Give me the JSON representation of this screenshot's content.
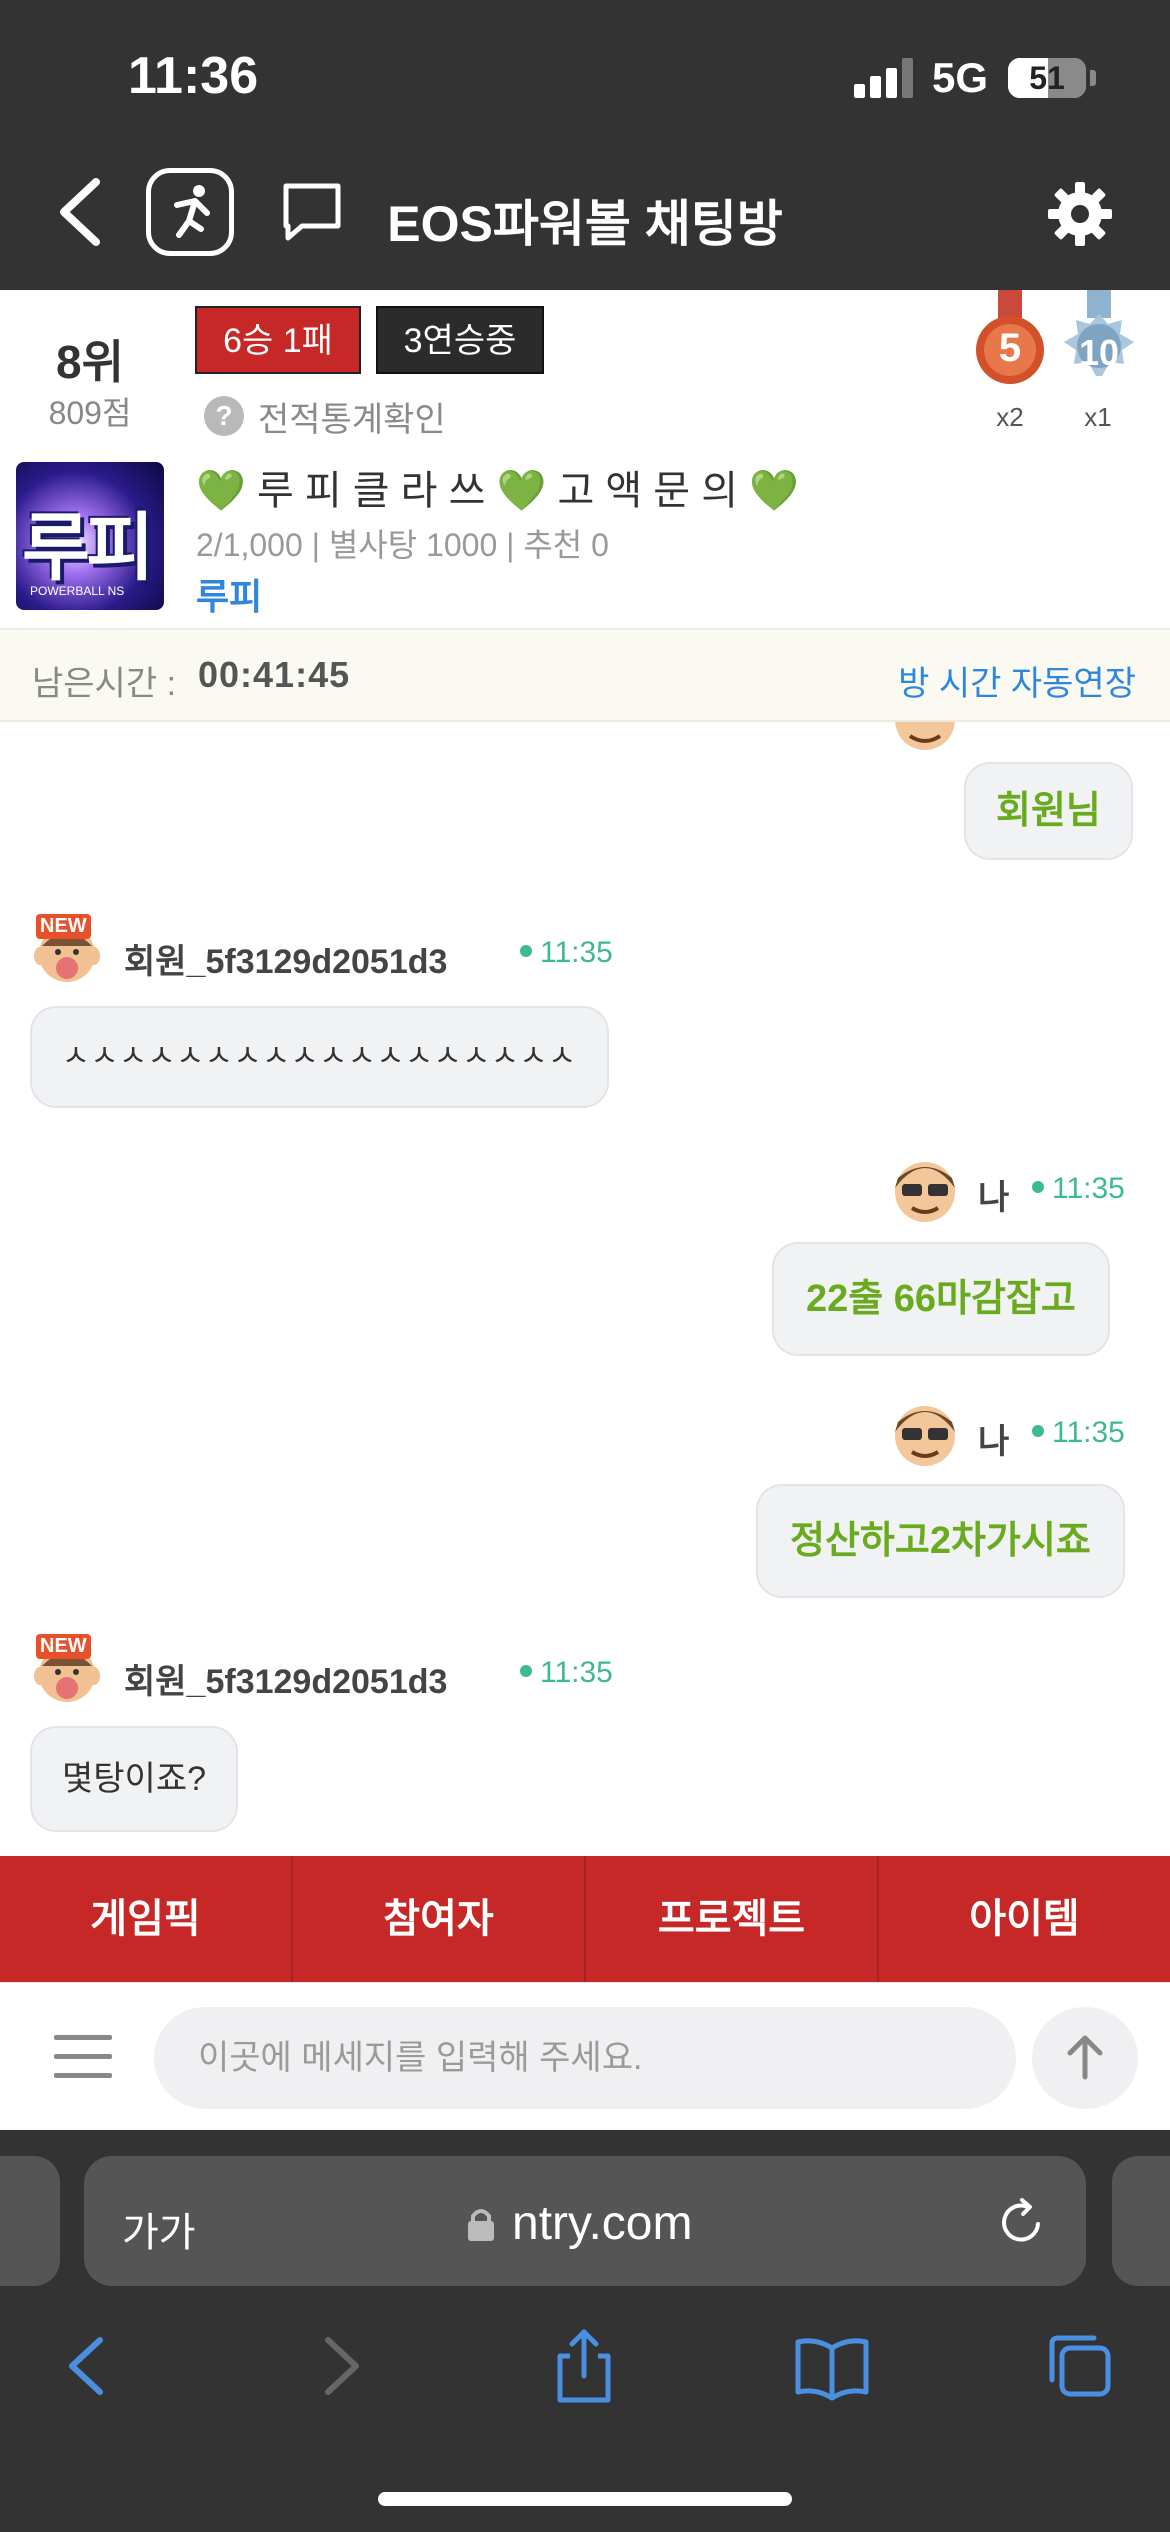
{
  "status_bar": {
    "time": "11:36",
    "network": "5G",
    "battery": "51"
  },
  "header": {
    "title": "EOS파워볼 채팅방"
  },
  "room": {
    "rank": "8위",
    "points": "809점",
    "record_badge": "6승 1패",
    "streak_badge": "3연승중",
    "stats_icon_glyph": "?",
    "stats_link": "전적통계확인",
    "medals": [
      {
        "label": "5",
        "count": "x2",
        "color": "#d2502a"
      },
      {
        "label": "10",
        "count": "x1",
        "color": "#8fb3cf"
      }
    ],
    "thumbnail_text": "루피",
    "thumbnail_subtext": "POWERBALL NS",
    "name_heart": "💚",
    "name_part1": "루 피 클 라 쓰",
    "name_part2": "고 액 문 의",
    "meta": "2/1,000 | 별사탕 1000 | 추천 0",
    "owner": "루피"
  },
  "timer": {
    "label": "남은시간 :",
    "value": "00:41:45",
    "extend_link": "방 시간 자동연장"
  },
  "messages": [
    {
      "id": "m0",
      "text": "회원님",
      "mine": true
    },
    {
      "id": "m1",
      "name": "회원_5f3129d2051d3",
      "time": "11:35",
      "text": "ㅅㅅㅅㅅㅅㅅㅅㅅㅅㅅㅅㅅㅅㅅㅅㅅㅅㅅ",
      "mine": false,
      "new_badge": "NEW"
    },
    {
      "id": "m2",
      "name": "나",
      "time": "11:35",
      "text": "22출 66마감잡고",
      "mine": true
    },
    {
      "id": "m3",
      "name": "나",
      "time": "11:35",
      "text": "정산하고2차가시죠",
      "mine": true
    },
    {
      "id": "m4",
      "name": "회원_5f3129d2051d3",
      "time": "11:35",
      "text": "몇탕이죠?",
      "mine": false,
      "new_badge": "NEW"
    }
  ],
  "tabs": [
    "게임픽",
    "참여자",
    "프로젝트",
    "아이템"
  ],
  "composer": {
    "placeholder": "이곳에 메세지를 입력해 주세요."
  },
  "browser": {
    "text_size_label": "가가",
    "url": "ntry.com"
  },
  "colors": {
    "accent_red": "#c62828",
    "link_blue": "#2e86de",
    "my_text_green": "#6aaa1e",
    "time_green": "#3dbb8c",
    "header_dark": "#333333"
  }
}
